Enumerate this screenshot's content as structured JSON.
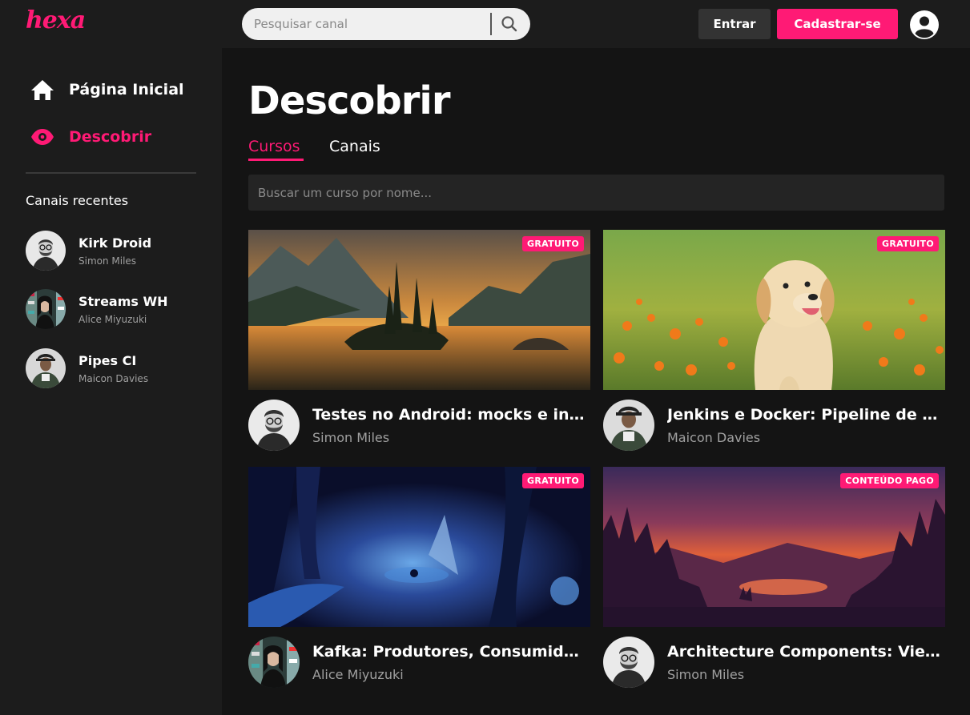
{
  "topbar": {
    "logo": "hexa",
    "search": {
      "placeholder": "Pesquisar canal",
      "value": ""
    },
    "login_label": "Entrar",
    "signup_label": "Cadastrar-se",
    "accent_color": "#ff1a75"
  },
  "sidebar": {
    "nav": [
      {
        "label": "Página Inicial",
        "icon": "home-icon",
        "active": false
      },
      {
        "label": "Descobrir",
        "icon": "eye-icon",
        "active": true
      }
    ],
    "recent_title": "Canais recentes",
    "channels": [
      {
        "name": "Kirk Droid",
        "author": "Simon Miles"
      },
      {
        "name": "Streams WH",
        "author": "Alice Miyuzuki"
      },
      {
        "name": "Pipes CI",
        "author": "Maicon Davies"
      }
    ]
  },
  "main": {
    "title": "Descobrir",
    "tabs": [
      {
        "label": "Cursos",
        "active": true
      },
      {
        "label": "Canais",
        "active": false
      }
    ],
    "course_search": {
      "placeholder": "Buscar um curso por nome...",
      "value": ""
    },
    "courses": [
      {
        "title": "Testes no Android: mocks e integração",
        "title_visible": "Testes no Android: mocks e int…",
        "author": "Simon Miles",
        "badge": "GRATUITO",
        "image": "mountain-lake-sunset"
      },
      {
        "title": "Jenkins e Docker: Pipeline de entrega",
        "title_visible": "Jenkins e Docker: Pipeline de e…",
        "author": "Maicon Davies",
        "badge": "GRATUITO",
        "image": "puppy-in-flowers"
      },
      {
        "title": "Kafka: Produtores, Consumidores",
        "title_visible": "Kafka: Produtores, Consumidor…",
        "author": "Alice Miyuzuki",
        "badge": "GRATUITO",
        "image": "blue-fantasy-forest"
      },
      {
        "title": "Architecture Components: ViewModel",
        "title_visible": "Architecture Components: Vie…",
        "author": "Simon Miles",
        "badge": "CONTEÚDO PAGO",
        "image": "sunset-forest-lake-deer"
      }
    ]
  }
}
